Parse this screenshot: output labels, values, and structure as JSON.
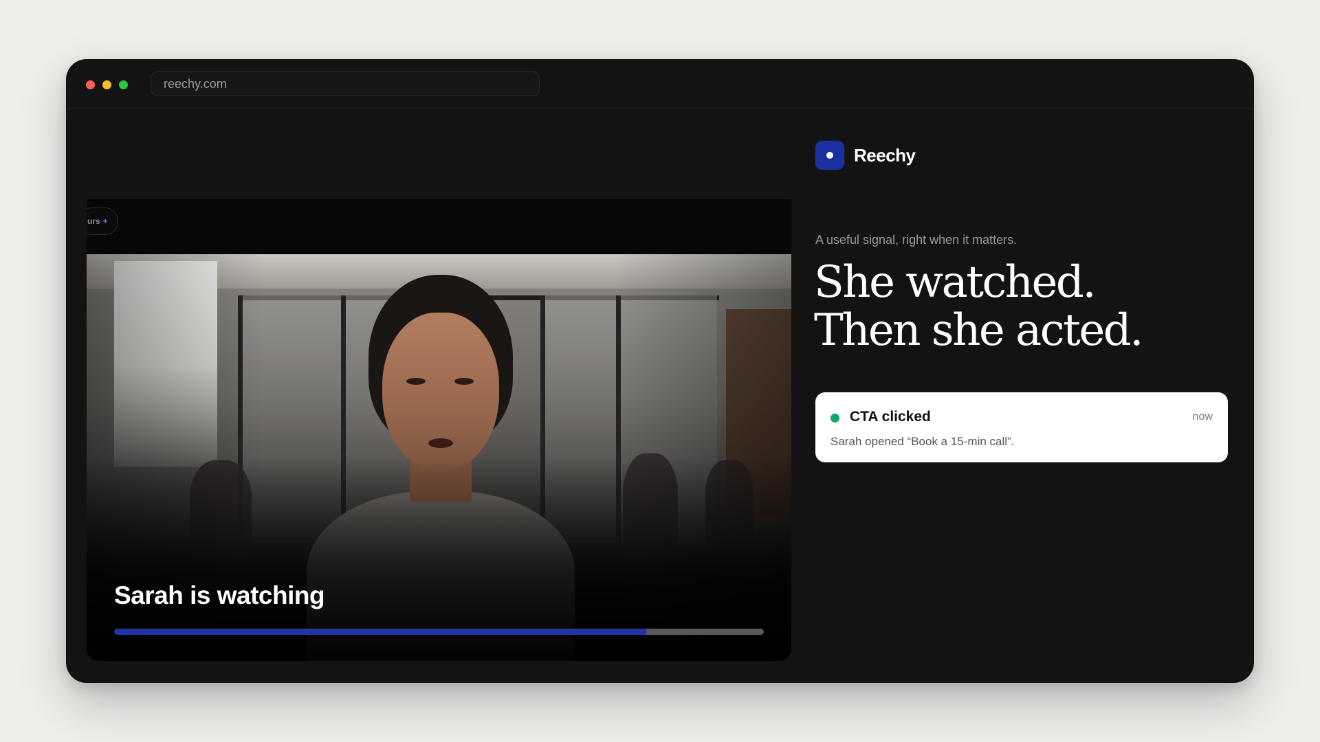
{
  "browser": {
    "url": "reechy.com",
    "traffic_lights": [
      "close",
      "minimize",
      "maximize"
    ]
  },
  "video": {
    "pill_label": "urs",
    "pill_icon": "plus-icon",
    "caption": "Sarah is watching",
    "progress_percent": 82
  },
  "brand": {
    "name": "Reechy",
    "accent_color": "#1a2fa0"
  },
  "hero": {
    "tagline": "A useful signal, right when it matters.",
    "headline_line1": "She watched.",
    "headline_line2": "Then she acted."
  },
  "event": {
    "status_color": "#12a66a",
    "title": "CTA clicked",
    "time": "now",
    "description": "Sarah opened “Book a 15-min call”."
  }
}
